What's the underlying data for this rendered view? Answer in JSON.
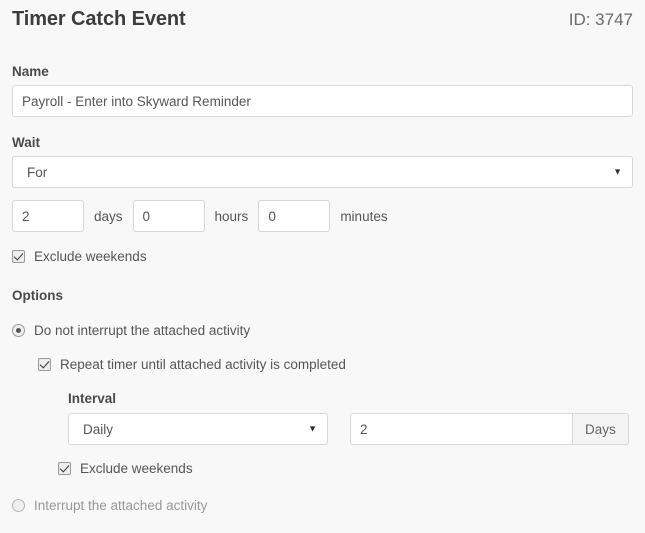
{
  "header": {
    "title": "Timer Catch Event",
    "id_text": "ID: 3747"
  },
  "name_field": {
    "label": "Name",
    "value": "Payroll - Enter into Skyward Reminder",
    "placeholder": "Name"
  },
  "wait": {
    "label": "Wait",
    "mode_value": "For",
    "caret_icon": "chevron-down-icon",
    "days_value": "2",
    "days_unit": "days",
    "hours_value": "0",
    "hours_unit": "hours",
    "minutes_value": "0",
    "minutes_unit": "minutes",
    "exclude_weekends_label": "Exclude weekends",
    "exclude_weekends_checked": true
  },
  "options": {
    "label": "Options",
    "do_not_interrupt": {
      "label": "Do not interrupt the attached activity",
      "selected": true
    },
    "repeat_timer": {
      "label": "Repeat timer until attached activity is completed",
      "checked": true
    },
    "interval": {
      "label": "Interval",
      "frequency_value": "Daily",
      "caret_icon": "chevron-down-icon",
      "amount_value": "2",
      "amount_unit": "Days",
      "exclude_weekends_label": "Exclude weekends",
      "exclude_weekends_checked": true
    },
    "interrupt": {
      "label": "Interrupt the attached activity",
      "selected": false
    }
  },
  "colors": {
    "page_background": "#f8f8f8",
    "input_background": "#ffffff",
    "border": "#d6d6d6",
    "text": "#555555",
    "heading": "#3c3c3c",
    "muted_text": "#989898",
    "addon_background": "#f4f4f4"
  }
}
